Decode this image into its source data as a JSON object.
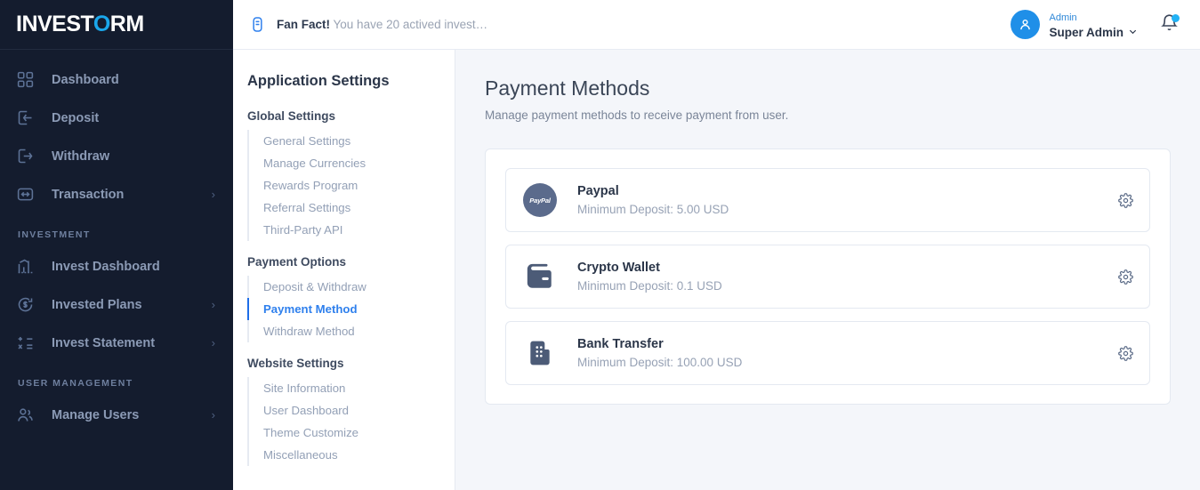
{
  "brand": {
    "text_before": "INVEST",
    "accent_letter": "O",
    "text_after": "RM"
  },
  "sidebar": {
    "items": [
      {
        "label": "Dashboard",
        "icon": "grid-icon",
        "caret": ""
      },
      {
        "label": "Deposit",
        "icon": "deposit-icon",
        "caret": ""
      },
      {
        "label": "Withdraw",
        "icon": "withdraw-icon",
        "caret": ""
      },
      {
        "label": "Transaction",
        "icon": "transaction-icon",
        "caret": "›"
      }
    ],
    "section_investment": "INVESTMENT",
    "investment_items": [
      {
        "label": "Invest Dashboard",
        "icon": "chart-bars-icon",
        "caret": ""
      },
      {
        "label": "Invested Plans",
        "icon": "refresh-dollar-icon",
        "caret": "›"
      },
      {
        "label": "Invest Statement",
        "icon": "calculator-icon",
        "caret": "›"
      }
    ],
    "section_user_management": "USER MANAGEMENT",
    "user_items": [
      {
        "label": "Manage Users",
        "icon": "users-icon",
        "caret": "›"
      }
    ]
  },
  "topbar": {
    "fanfact_bold": "Fan Fact!",
    "fanfact_rest": " You have 20 actived invest…",
    "fanfact_icon": "note-icon",
    "profile": {
      "role": "Admin",
      "name": "Super Admin",
      "chevron": "⌄",
      "avatar_icon": "user-icon"
    },
    "bell_icon": "bell-icon"
  },
  "settings": {
    "title": "Application Settings",
    "groups": [
      {
        "title": "Global Settings",
        "links": [
          {
            "label": "General Settings",
            "active": false
          },
          {
            "label": "Manage Currencies",
            "active": false
          },
          {
            "label": "Rewards Program",
            "active": false
          },
          {
            "label": "Referral Settings",
            "active": false
          },
          {
            "label": "Third-Party API",
            "active": false
          }
        ]
      },
      {
        "title": "Payment Options",
        "links": [
          {
            "label": "Deposit & Withdraw",
            "active": false
          },
          {
            "label": "Payment Method",
            "active": true
          },
          {
            "label": "Withdraw Method",
            "active": false
          }
        ]
      },
      {
        "title": "Website Settings",
        "links": [
          {
            "label": "Site Information",
            "active": false
          },
          {
            "label": "User Dashboard",
            "active": false
          },
          {
            "label": "Theme Customize",
            "active": false
          },
          {
            "label": "Miscellaneous",
            "active": false
          }
        ]
      }
    ]
  },
  "main": {
    "title": "Payment Methods",
    "subtitle": "Manage payment methods to receive payment from user.",
    "payment_methods": [
      {
        "name": "Paypal",
        "minimum": "Minimum Deposit: 5.00 USD",
        "icon": "paypal-icon",
        "gear": "gear-icon"
      },
      {
        "name": "Crypto Wallet",
        "minimum": "Minimum Deposit: 0.1 USD",
        "icon": "wallet-icon",
        "gear": "gear-icon"
      },
      {
        "name": "Bank Transfer",
        "minimum": "Minimum Deposit: 100.00 USD",
        "icon": "bank-icon",
        "gear": "gear-icon"
      }
    ]
  },
  "colors": {
    "sidebar_bg": "#141c2e",
    "accent_blue": "#2f80ed",
    "brand_accent": "#1aa7ec",
    "page_bg": "#f4f6fa",
    "icon_slate": "#5b6b87"
  }
}
